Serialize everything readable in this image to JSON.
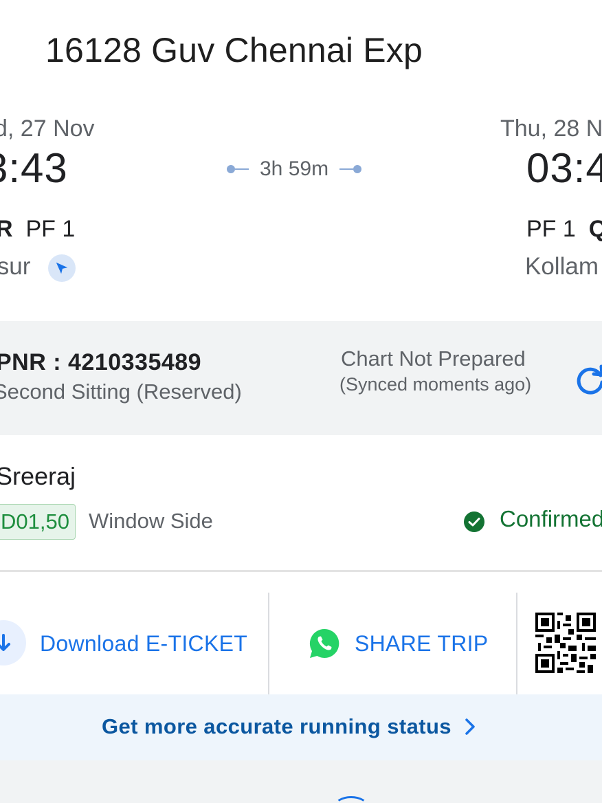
{
  "train": {
    "title": "16128 Guv Chennai Exp"
  },
  "departure": {
    "date": "d, 27 Nov",
    "time": "3:43",
    "station_code": "R",
    "platform": "PF 1",
    "station_name": "isur"
  },
  "arrival": {
    "date": "Thu, 28 N",
    "time": "03:4",
    "platform": "PF 1",
    "station_code": "Q",
    "station_name": "Kollam"
  },
  "duration": "3h 59m",
  "booking": {
    "pnr": "PNR : 4210335489",
    "class": "Second Sitting (Reserved)",
    "chart_status": "Chart Not Prepared",
    "sync_status": "(Synced moments ago)"
  },
  "passenger": {
    "name": "Sreeraj",
    "seat": "D01,50",
    "berth": "Window Side",
    "status": "Confirmed"
  },
  "actions": {
    "download_label": "Download E-TICKET",
    "share_label": "SHARE TRIP"
  },
  "running_status": {
    "label": "Get more accurate running status"
  },
  "icons": {
    "navigate": "navigate-icon",
    "refresh": "refresh-icon",
    "confirmed": "check-circle-icon",
    "download": "download-icon",
    "whatsapp": "whatsapp-icon",
    "qr": "qr-code-icon",
    "chevron": "chevron-right-icon"
  },
  "colors": {
    "accent": "#1a73e8",
    "confirmed": "#137333",
    "seat_bg": "#e6f4ea",
    "whatsapp": "#25d366"
  }
}
